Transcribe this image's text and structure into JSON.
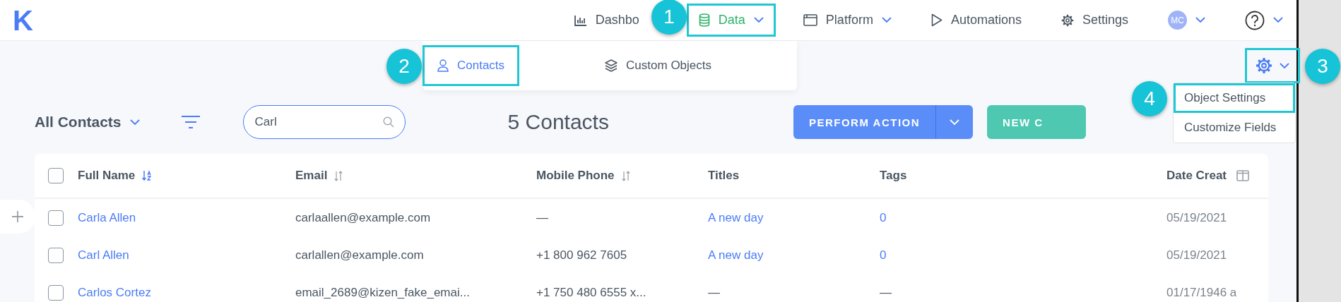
{
  "logo": "K",
  "nav": [
    {
      "kind": "link",
      "label": "Dashbo",
      "selected": false,
      "highlighted": false,
      "dropdown": false
    },
    {
      "kind": "link",
      "label": "Data",
      "selected": true,
      "highlighted": true,
      "dropdown": true
    },
    {
      "kind": "link",
      "label": "Platform",
      "selected": false,
      "highlighted": false,
      "dropdown": true
    },
    {
      "kind": "link",
      "label": "Automations",
      "selected": false,
      "highlighted": false,
      "dropdown": false
    },
    {
      "kind": "link",
      "label": "Settings",
      "selected": false,
      "highlighted": false,
      "dropdown": false
    },
    {
      "kind": "avatar",
      "label": "MC",
      "selected": false,
      "highlighted": false,
      "dropdown": true
    },
    {
      "kind": "help",
      "selected": false,
      "highlighted": false,
      "dropdown": true
    }
  ],
  "submenu": [
    {
      "label": "Contacts",
      "selected": true,
      "highlighted": true
    },
    {
      "label": "Custom Objects",
      "selected": false,
      "highlighted": false
    }
  ],
  "annotations": [
    {
      "label": "1"
    },
    {
      "label": "2"
    },
    {
      "label": "3"
    },
    {
      "label": "4"
    }
  ],
  "toolbar": {
    "view": "All Contacts",
    "search": {
      "value": "Carl"
    },
    "count": "5 Contacts",
    "primary_button": "PERFORM ACTION",
    "secondary_button": "NEW C"
  },
  "gear_menu": {
    "highlighted": true,
    "items": [
      {
        "label": "Object Settings",
        "highlighted": true
      },
      {
        "label": "Customize Fields",
        "highlighted": false
      }
    ]
  },
  "table": {
    "select_all_checked": false,
    "columns": [
      {
        "label": "Full Name",
        "kind": "sorted"
      },
      {
        "label": "Email",
        "kind": "sortable"
      },
      {
        "label": "Mobile Phone",
        "kind": "sortable"
      },
      {
        "label": "Titles",
        "kind": "plain"
      },
      {
        "label": "Tags",
        "kind": "plain"
      },
      {
        "label": "Date Creat",
        "kind": "plain"
      }
    ],
    "rows": [
      {
        "checked": false,
        "cells": [
          {
            "text": "Carla Allen",
            "kind": "link"
          },
          {
            "text": "carlaallen@example.com",
            "kind": "text"
          },
          {
            "text": "—",
            "kind": "text"
          },
          {
            "text": "A new day",
            "kind": "link"
          },
          {
            "text": "0",
            "kind": "link"
          },
          {
            "text": "05/19/2021",
            "kind": "text"
          }
        ]
      },
      {
        "checked": false,
        "cells": [
          {
            "text": "Carl Allen",
            "kind": "link"
          },
          {
            "text": "carlallen@example.com",
            "kind": "text"
          },
          {
            "text": "+1 800 962 7605",
            "kind": "text"
          },
          {
            "text": "A new day",
            "kind": "link"
          },
          {
            "text": "0",
            "kind": "link"
          },
          {
            "text": "05/19/2021",
            "kind": "text"
          }
        ]
      },
      {
        "checked": false,
        "cells": [
          {
            "text": "Carlos Cortez",
            "kind": "link"
          },
          {
            "text": "email_2689@kizen_fake_emai...",
            "kind": "text"
          },
          {
            "text": "+1 750 480 6555 x...",
            "kind": "text"
          },
          {
            "text": "—",
            "kind": "text"
          },
          {
            "text": "—",
            "kind": "text"
          },
          {
            "text": "01/17/1946 a",
            "kind": "text"
          }
        ]
      }
    ]
  }
}
